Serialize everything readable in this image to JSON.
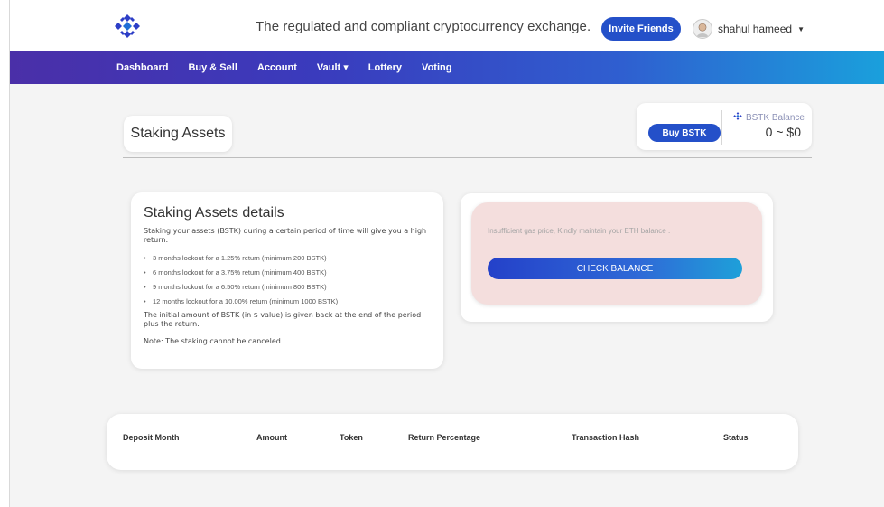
{
  "header": {
    "tagline": "The regulated and compliant cryptocurrency exchange.",
    "invite_label": "Invite Friends",
    "user_name": "shahul hameed",
    "logo_icon": "bstk-logo-icon",
    "brand_color": "#2450c9"
  },
  "nav": {
    "items": [
      {
        "label": "Dashboard"
      },
      {
        "label": "Buy & Sell"
      },
      {
        "label": "Account"
      },
      {
        "label": "Vault"
      },
      {
        "label": "Lottery"
      },
      {
        "label": "Voting"
      }
    ],
    "vault_caret": "▾"
  },
  "page": {
    "title": "Staking Assets"
  },
  "balance": {
    "buy_label": "Buy BSTK",
    "label": "BSTK Balance",
    "value": "0 ~ $0"
  },
  "details": {
    "title": "Staking Assets details",
    "intro": "Staking your assets (BSTK) during a certain period of time will give you a high return:",
    "items": [
      "3 months lockout for a 1.25% return (minimum 200 BSTK)",
      "6 months lockout for a 3.75% return (minimum 400 BSTK)",
      "9 months lockout for a 6.50% return (minimum 800 BSTK)",
      "12 months lockout for a 10.00% return (minimum 1000 BSTK)"
    ],
    "outro": "The initial amount of BSTK (in $ value) is given back at the end of the period plus the return.",
    "note": "Note: The staking cannot be canceled."
  },
  "gas": {
    "message": "Insufficient gas price, Kindly maintain your ETH balance .",
    "button_label": "CHECK BALANCE",
    "warning_bg": "#f4dedd"
  },
  "table": {
    "columns": [
      "Deposit Month",
      "Amount",
      "Token",
      "Return Percentage",
      "Transaction Hash",
      "Status"
    ],
    "rows": []
  }
}
